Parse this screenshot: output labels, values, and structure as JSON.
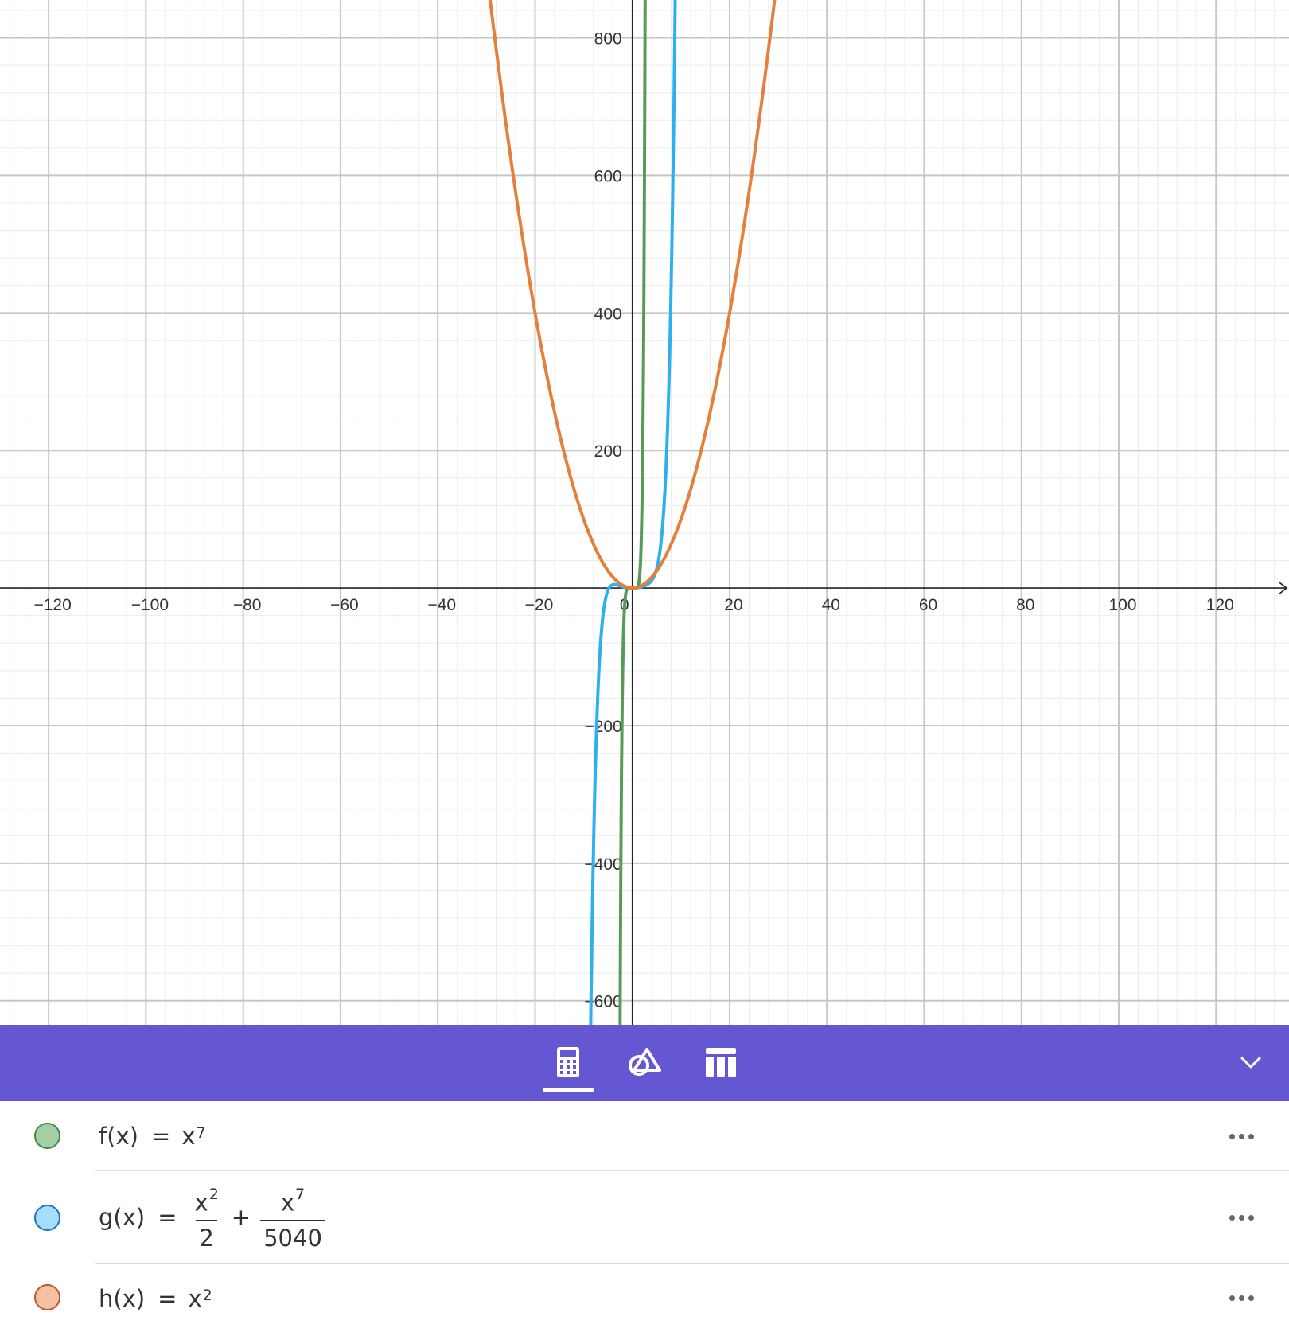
{
  "graph": {
    "x_range": [
      -130,
      135
    ],
    "y_range": [
      -635,
      855
    ],
    "x_ticks": [
      "−120",
      "−100",
      "−80",
      "−60",
      "−40",
      "−20",
      "0",
      "20",
      "40",
      "60",
      "80",
      "100",
      "120"
    ],
    "y_ticks": [
      "800",
      "600",
      "400",
      "200",
      "−200",
      "−400",
      "−600"
    ],
    "major_grid_x_step": 20,
    "major_grid_y_step": 200,
    "minor_grid_x_step": 4,
    "minor_grid_y_step": 40
  },
  "chart_data": {
    "type": "line",
    "x_range": [
      -130,
      135
    ],
    "y_range": [
      -635,
      855
    ],
    "grid": true,
    "series": [
      {
        "name": "f(x)",
        "function": "x^7",
        "color": "#559b59"
      },
      {
        "name": "g(x)",
        "function": "x^2/2 + x^7/5040",
        "color": "#2cb0f0"
      },
      {
        "name": "h(x)",
        "function": "x^2",
        "color": "#e47f3c"
      }
    ]
  },
  "toolbar": {
    "tabs": [
      {
        "icon": "calculator-icon",
        "active": true
      },
      {
        "icon": "geometry-tools-icon",
        "active": false
      },
      {
        "icon": "table-icon",
        "active": false
      }
    ],
    "collapse_icon": "chevron-down-icon",
    "background": "#6557d2"
  },
  "algebra": {
    "rows": [
      {
        "name": "f(x)",
        "equals": "=",
        "base": "x",
        "exp": "7",
        "dot_fill": "#a6cfa8",
        "dot_border": "#3f8a43"
      },
      {
        "name": "g(x)",
        "equals": "=",
        "term1_num_base": "x",
        "term1_num_exp": "2",
        "term1_den": "2",
        "plus": "+",
        "term2_num_base": "x",
        "term2_num_exp": "7",
        "term2_den": "5040",
        "dot_fill": "#a6dcfc",
        "dot_border": "#1a73c8"
      },
      {
        "name": "h(x)",
        "equals": "=",
        "base": "x",
        "exp": "2",
        "dot_fill": "#f4c2a2",
        "dot_border": "#c8522a"
      }
    ]
  }
}
